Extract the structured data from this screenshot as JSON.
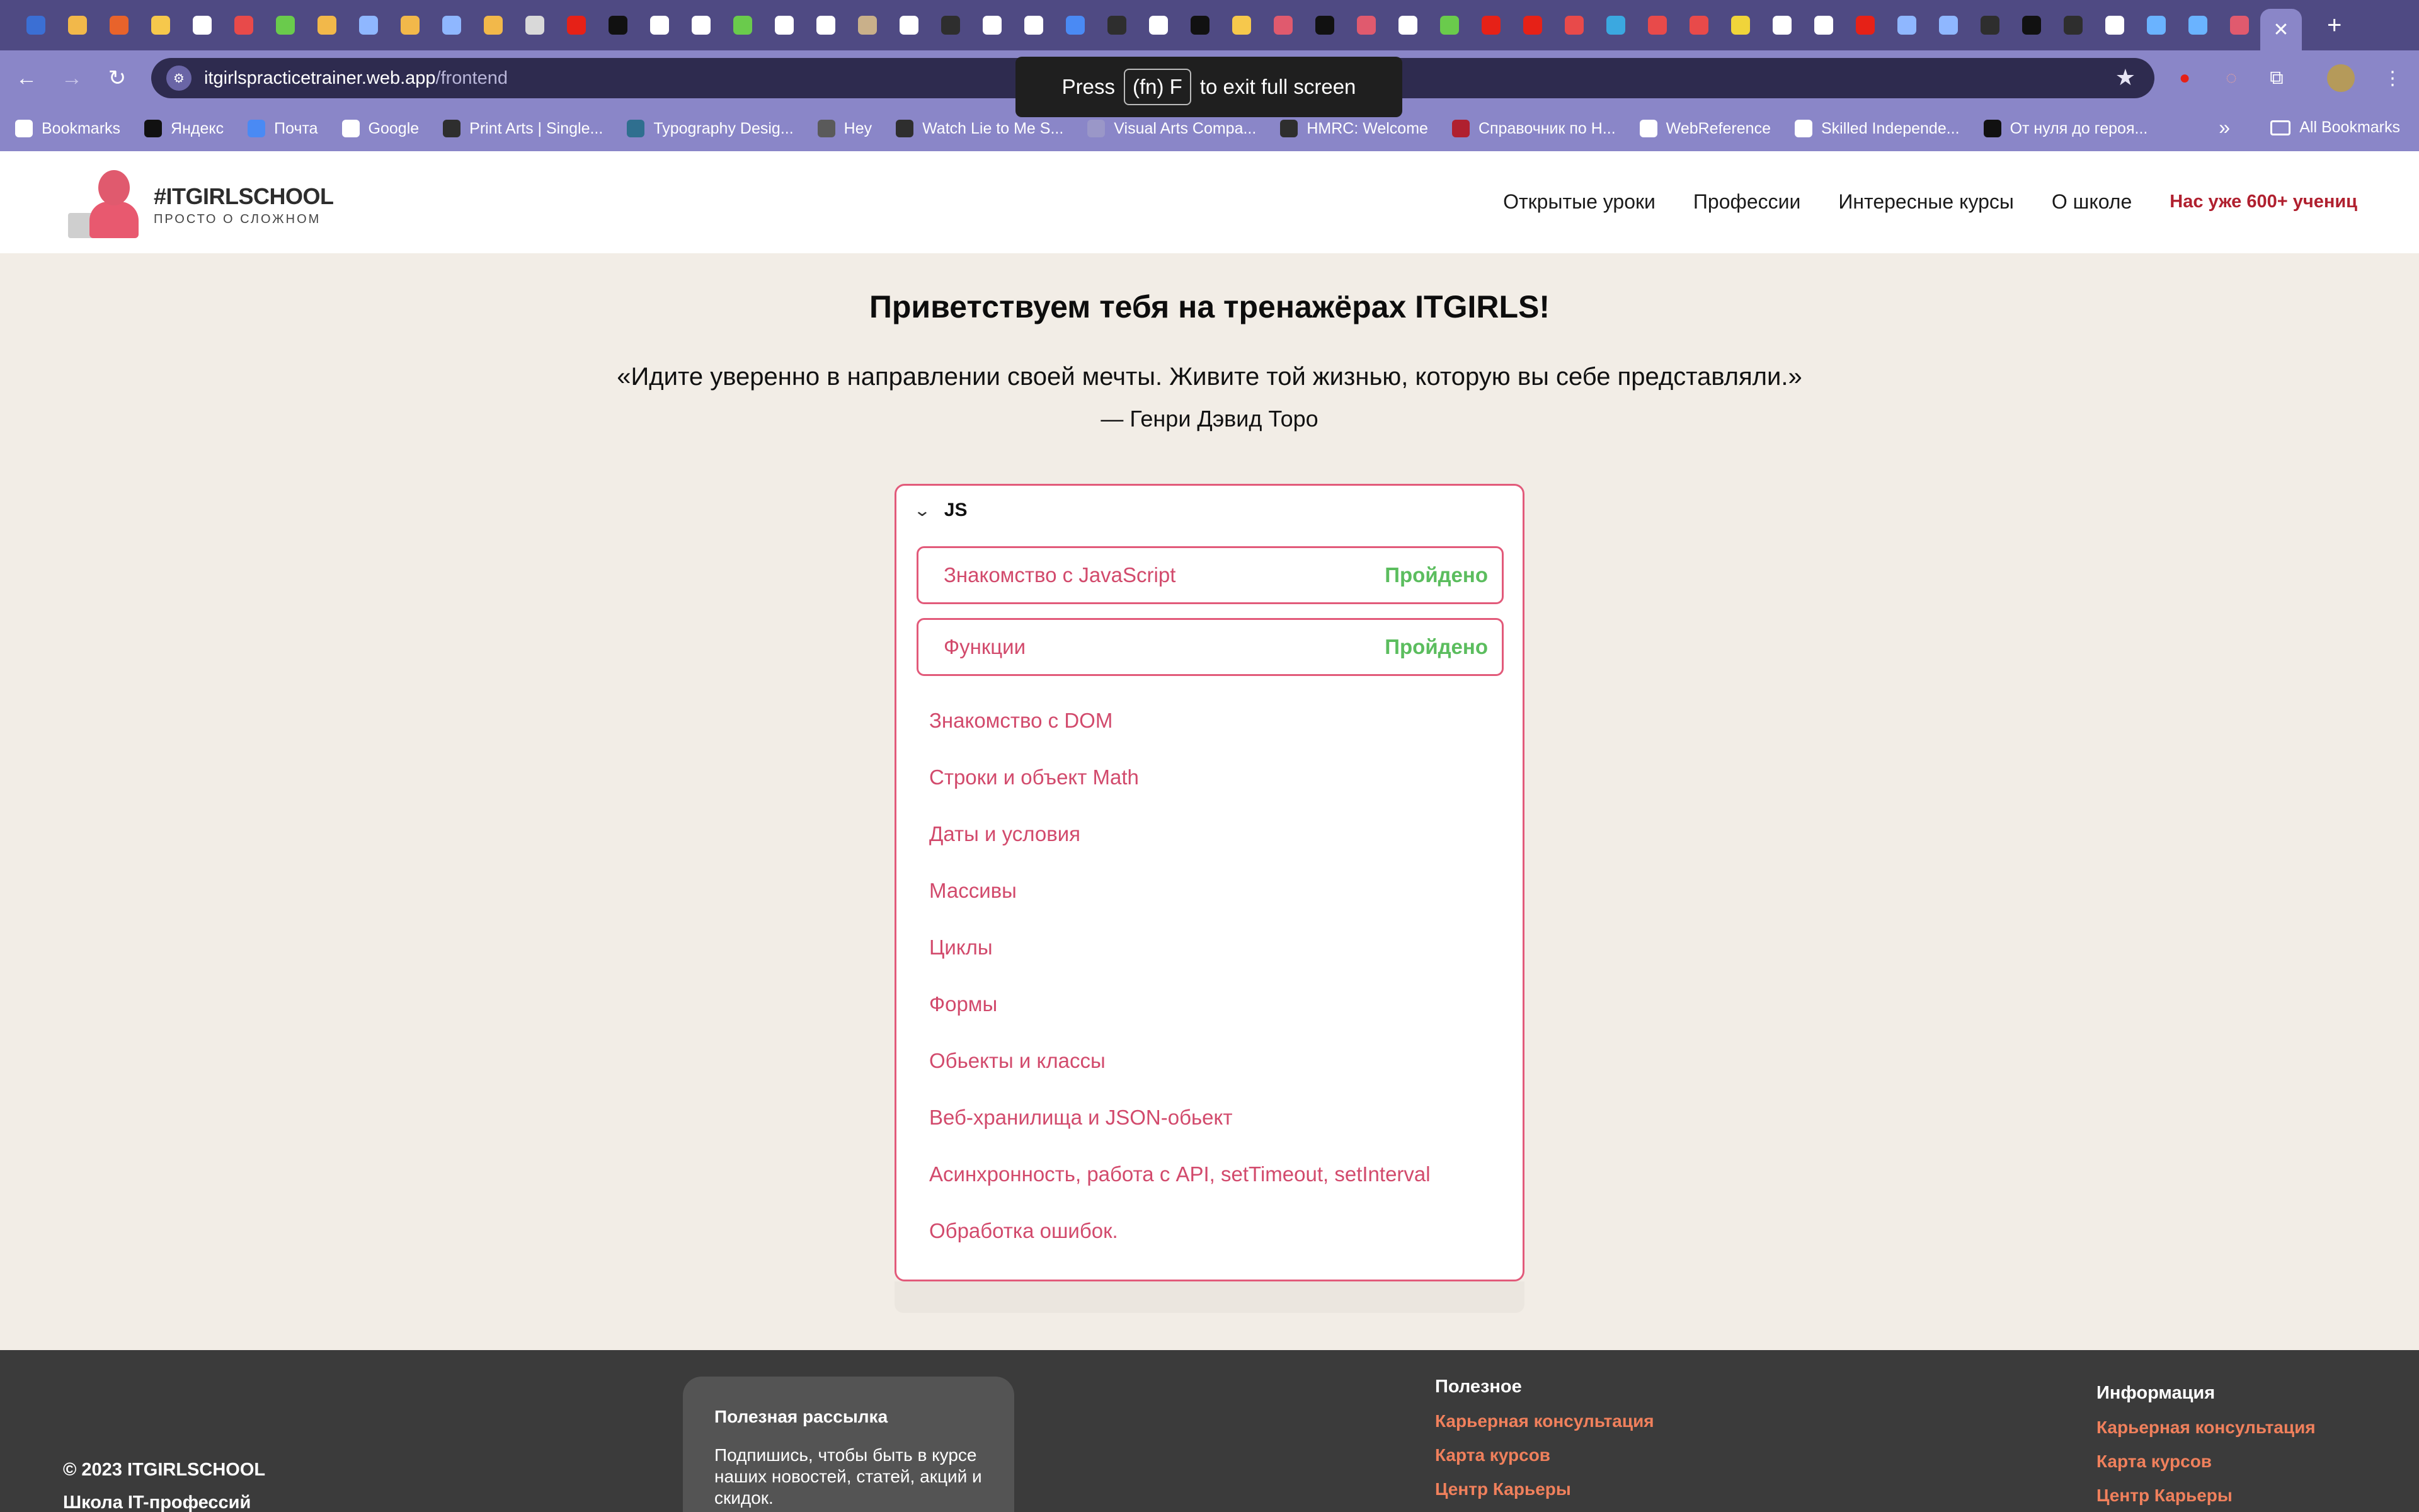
{
  "browser": {
    "favicon_colors": [
      "#3b6fd4",
      "#f2b84a",
      "#e8632b",
      "#f6c84c",
      "#ffffff",
      "#e84a4a",
      "#6acb4c",
      "#f2b84a",
      "#8fb7ff",
      "#f2b84a",
      "#8fb7ff",
      "#f2b84a",
      "#d9d9d9",
      "#e62117",
      "#111111",
      "#ffffff",
      "#ffffff",
      "#6acb4c",
      "#ffffff",
      "#ffffff",
      "#c9b08a",
      "#ffffff",
      "#2e2e2e",
      "#ffffff",
      "#ffffff",
      "#4a8af4",
      "#2e2e2e",
      "#ffffff",
      "#111111",
      "#f6c84c",
      "#e05a6e",
      "#111111",
      "#e05a6e",
      "#ffffff",
      "#6acb4c",
      "#e62117",
      "#e62117",
      "#e84a4a",
      "#3ba8e0",
      "#e84a4a",
      "#e84a4a",
      "#f0d43a",
      "#ffffff",
      "#ffffff",
      "#e62117",
      "#8fb7ff",
      "#8fb7ff",
      "#2e2e2e",
      "#111111",
      "#2e2e2e",
      "#ffffff",
      "#6ab3ff",
      "#6ab3ff",
      "#e05a6e"
    ],
    "active_tab_close": "✕",
    "new_tab": "+",
    "back": "←",
    "forward": "→",
    "reload": "↻",
    "url_host": "itgirlspracticetrainer.web.app",
    "url_path": "/frontend",
    "fullscreen_toast": {
      "press": "Press",
      "key": "(fn) F",
      "rest": "to exit full screen"
    },
    "bookmarks": [
      {
        "label": "Bookmarks",
        "color": "#ffffff"
      },
      {
        "label": "Яндекс",
        "color": "#111111"
      },
      {
        "label": "Почта",
        "color": "#4a8af4"
      },
      {
        "label": "Google",
        "color": "#ffffff"
      },
      {
        "label": "Print Arts | Single...",
        "color": "#2e2e2e"
      },
      {
        "label": "Typography Desig...",
        "color": "#2f6f8f"
      },
      {
        "label": "Hey",
        "color": "#5a5a5a"
      },
      {
        "label": "Watch Lie to Me S...",
        "color": "#2e2e2e"
      },
      {
        "label": "Visual Arts Compa...",
        "color": "#9a97c8"
      },
      {
        "label": "HMRC: Welcome",
        "color": "#2e2e2e"
      },
      {
        "label": "Справочник по H...",
        "color": "#b0202f"
      },
      {
        "label": "WebReference",
        "color": "#ffffff"
      },
      {
        "label": "Skilled Independe...",
        "color": "#ffffff"
      },
      {
        "label": "От нуля до героя...",
        "color": "#111111"
      }
    ],
    "more_bookmarks": "»",
    "all_bookmarks": "All Bookmarks"
  },
  "site": {
    "brand": "#ITGIRLSCHOOL",
    "tagline": "ПРОСТО О СЛОЖНОМ",
    "nav": [
      "Открытые уроки",
      "Профессии",
      "Интересные курсы",
      "О школе"
    ],
    "nav_cta": "Нас уже 600+ учениц"
  },
  "main": {
    "welcome": "Приветствуем тебя на тренажёрах ITGIRLS!",
    "quote": "«Идите уверенно в направлении своей мечты. Живите той жизнью, которую вы себе представляли.»",
    "quote_author": "— Генри Дэвид Торо",
    "section_title": "JS",
    "completed_lessons": [
      {
        "name": "Знакомство с JavaScript",
        "status": "Пройдено"
      },
      {
        "name": "Функции",
        "status": "Пройдено"
      }
    ],
    "lessons": [
      "Знакомство с DOM",
      "Строки и объект Math",
      "Даты и условия",
      "Массивы",
      "Циклы",
      "Формы",
      "Обьекты и классы",
      "Веб-хранилища и JSON-обьект",
      "Асинхронность, работа с API, setTimeout, setInterval",
      "Обработка ошибок."
    ]
  },
  "footer": {
    "copyright": "© 2023 ITGIRLSCHOOL",
    "school": "Школа IT-профессий",
    "newsletter_title": "Полезная рассылка",
    "newsletter_text": "Подпишись, чтобы быть в курсе наших новостей, статей, акций и скидок.",
    "useful_title": "Полезное",
    "useful_links": [
      "Карьерная консультация",
      "Карта курсов",
      "Центр Карьеры"
    ],
    "info_title": "Информация",
    "info_links": [
      "Карьерная консультация",
      "Карта курсов",
      "Центр Карьеры"
    ]
  }
}
